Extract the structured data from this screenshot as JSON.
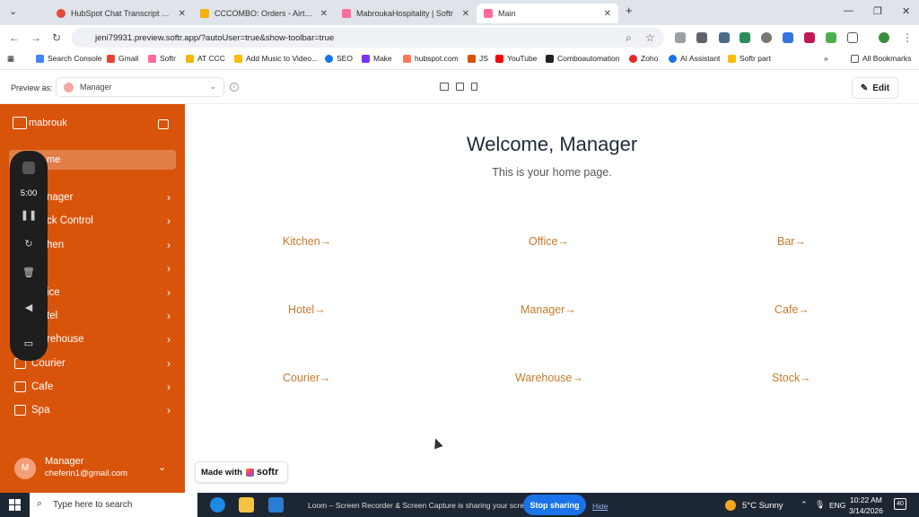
{
  "browser": {
    "tabs": [
      {
        "label": "HubSpot Chat Transcript Analy",
        "color": "#e04a3a"
      },
      {
        "label": "CCCOMBO: Orders - Airtable",
        "color": "#f4b400"
      },
      {
        "label": "MabroukaHospitality | Softr",
        "color": "#ff6b9a"
      },
      {
        "label": "Main",
        "color": "#ff6b9a"
      }
    ],
    "url": "jeni79931.preview.softr.app/?autoUser=true&show-toolbar=true",
    "bookmarks": [
      "Search Console",
      "Gmail",
      "Softr",
      "AT CCC",
      "Add Music to Video...",
      "SEO",
      "Make",
      "hubspot.com",
      "JS",
      "YouTube",
      "Comboautomation",
      "Zoho",
      "AI Assistant",
      "Softr part"
    ],
    "all_bookmarks": "All Bookmarks"
  },
  "preview_toolbar": {
    "label": "Preview as:",
    "role": "Manager",
    "edit": "Edit"
  },
  "sidebar": {
    "brand": "mabrouk",
    "home": "me",
    "items": [
      {
        "label": "nager"
      },
      {
        "label": "ck Control"
      },
      {
        "label": "hen"
      },
      {
        "label": ""
      },
      {
        "label": "ice"
      },
      {
        "label": "tel"
      },
      {
        "label": "rehouse"
      },
      {
        "label": "Courier"
      },
      {
        "label": "Cafe"
      },
      {
        "label": "Spa"
      }
    ],
    "user": {
      "initial": "M",
      "name": "Manager",
      "email": "cheferin1@gmail.com"
    }
  },
  "loom": {
    "timer": "5:00"
  },
  "main": {
    "title": "Welcome, Manager",
    "subtitle": "This is your home page.",
    "links": [
      "Kitchen",
      "Office",
      "Bar",
      "Hotel",
      "Manager",
      "Cafe",
      "Courier",
      "Warehouse",
      "Stock"
    ],
    "arrow": "→"
  },
  "made_with": {
    "text": "Made with",
    "brand": "softr"
  },
  "taskbar": {
    "search": "Type here to search",
    "share_text": "Loom – Screen Recorder & Screen Capture is sharing your screen.",
    "stop_sharing": "Stop sharing",
    "hide": "Hide",
    "weather": "5°C  Sunny",
    "lang": "ENG",
    "time": "10:22 AM",
    "date": "3/14/2026",
    "notifications": "40"
  }
}
